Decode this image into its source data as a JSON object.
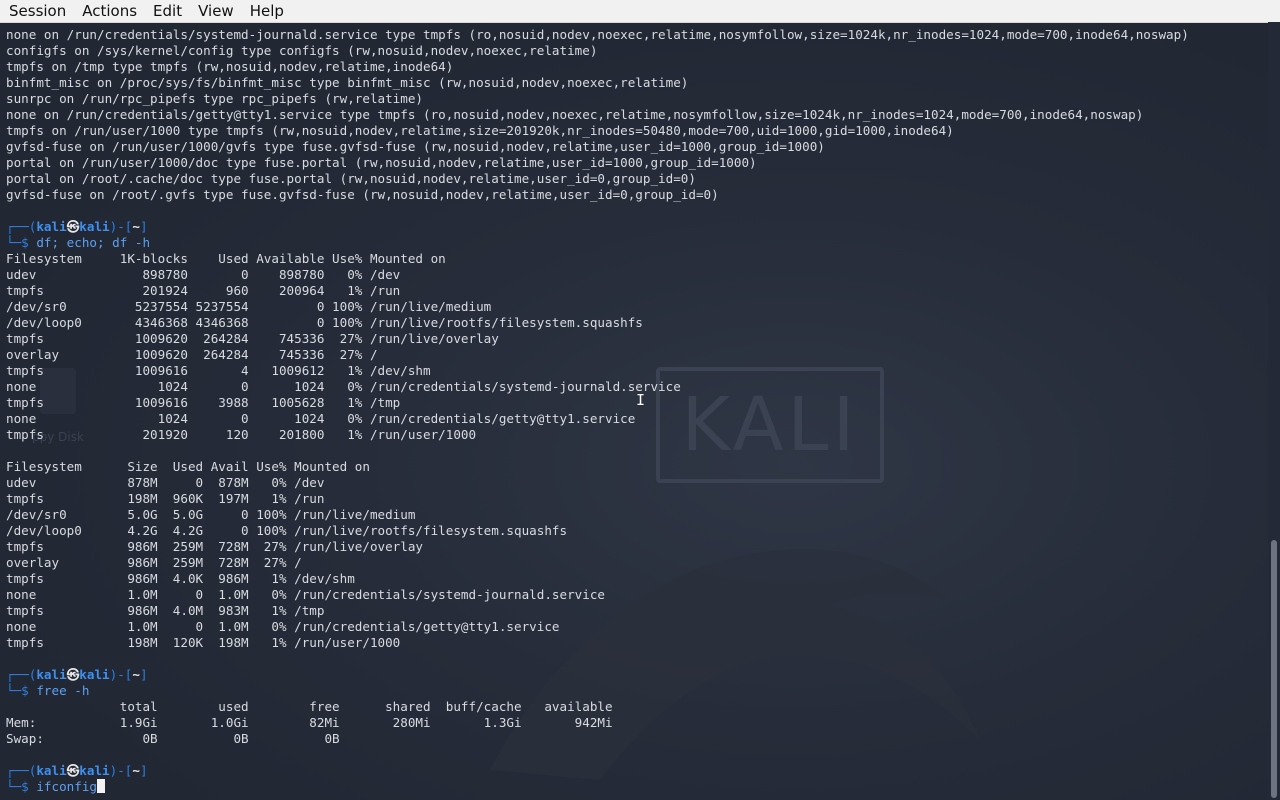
{
  "menu": [
    "Session",
    "Actions",
    "Edit",
    "View",
    "Help"
  ],
  "mount_lines": [
    "none on /run/credentials/systemd-journald.service type tmpfs (ro,nosuid,nodev,noexec,relatime,nosymfollow,size=1024k,nr_inodes=1024,mode=700,inode64,noswap)",
    "configfs on /sys/kernel/config type configfs (rw,nosuid,nodev,noexec,relatime)",
    "tmpfs on /tmp type tmpfs (rw,nosuid,nodev,relatime,inode64)",
    "binfmt_misc on /proc/sys/fs/binfmt_misc type binfmt_misc (rw,nosuid,nodev,noexec,relatime)",
    "sunrpc on /run/rpc_pipefs type rpc_pipefs (rw,relatime)",
    "none on /run/credentials/getty@tty1.service type tmpfs (ro,nosuid,nodev,noexec,relatime,nosymfollow,size=1024k,nr_inodes=1024,mode=700,inode64,noswap)",
    "tmpfs on /run/user/1000 type tmpfs (rw,nosuid,nodev,relatime,size=201920k,nr_inodes=50480,mode=700,uid=1000,gid=1000,inode64)",
    "gvfsd-fuse on /run/user/1000/gvfs type fuse.gvfsd-fuse (rw,nosuid,nodev,relatime,user_id=1000,group_id=1000)",
    "portal on /run/user/1000/doc type fuse.portal (rw,nosuid,nodev,relatime,user_id=1000,group_id=1000)",
    "portal on /root/.cache/doc type fuse.portal (rw,nosuid,nodev,relatime,user_id=0,group_id=0)",
    "gvfsd-fuse on /root/.gvfs type fuse.gvfsd-fuse (rw,nosuid,nodev,relatime,user_id=0,group_id=0)"
  ],
  "prompt": {
    "top_left": "┌──(",
    "user": "kali",
    "at": "㉿",
    "host": "kali",
    "mid": ")-[",
    "dir": "~",
    "end": "]",
    "bottom": "└─$ "
  },
  "commands": [
    "df; echo; df -h",
    "free -h",
    "ifconfig"
  ],
  "df_lines": [
    "Filesystem     1K-blocks    Used Available Use% Mounted on",
    "udev              898780       0    898780   0% /dev",
    "tmpfs             201924     960    200964   1% /run",
    "/dev/sr0         5237554 5237554         0 100% /run/live/medium",
    "/dev/loop0       4346368 4346368         0 100% /run/live/rootfs/filesystem.squashfs",
    "tmpfs            1009620  264284    745336  27% /run/live/overlay",
    "overlay          1009620  264284    745336  27% /",
    "tmpfs            1009616       4   1009612   1% /dev/shm",
    "none                1024       0      1024   0% /run/credentials/systemd-journald.service",
    "tmpfs            1009616    3988   1005628   1% /tmp",
    "none                1024       0      1024   0% /run/credentials/getty@tty1.service",
    "tmpfs             201920     120    201800   1% /run/user/1000"
  ],
  "dfh_lines": [
    "Filesystem      Size  Used Avail Use% Mounted on",
    "udev            878M     0  878M   0% /dev",
    "tmpfs           198M  960K  197M   1% /run",
    "/dev/sr0        5.0G  5.0G     0 100% /run/live/medium",
    "/dev/loop0      4.2G  4.2G     0 100% /run/live/rootfs/filesystem.squashfs",
    "tmpfs           986M  259M  728M  27% /run/live/overlay",
    "overlay         986M  259M  728M  27% /",
    "tmpfs           986M  4.0K  986M   1% /dev/shm",
    "none            1.0M     0  1.0M   0% /run/credentials/systemd-journald.service",
    "tmpfs           986M  4.0M  983M   1% /tmp",
    "none            1.0M     0  1.0M   0% /run/credentials/getty@tty1.service",
    "tmpfs           198M  120K  198M   1% /run/user/1000"
  ],
  "free_lines": [
    "               total        used        free      shared  buff/cache   available",
    "Mem:           1.9Gi       1.0Gi        82Mi       280Mi       1.3Gi       942Mi",
    "Swap:             0B          0B          0B"
  ],
  "background": {
    "logo_text": "KALI",
    "desktop_icon_label": "ppy Disk"
  }
}
